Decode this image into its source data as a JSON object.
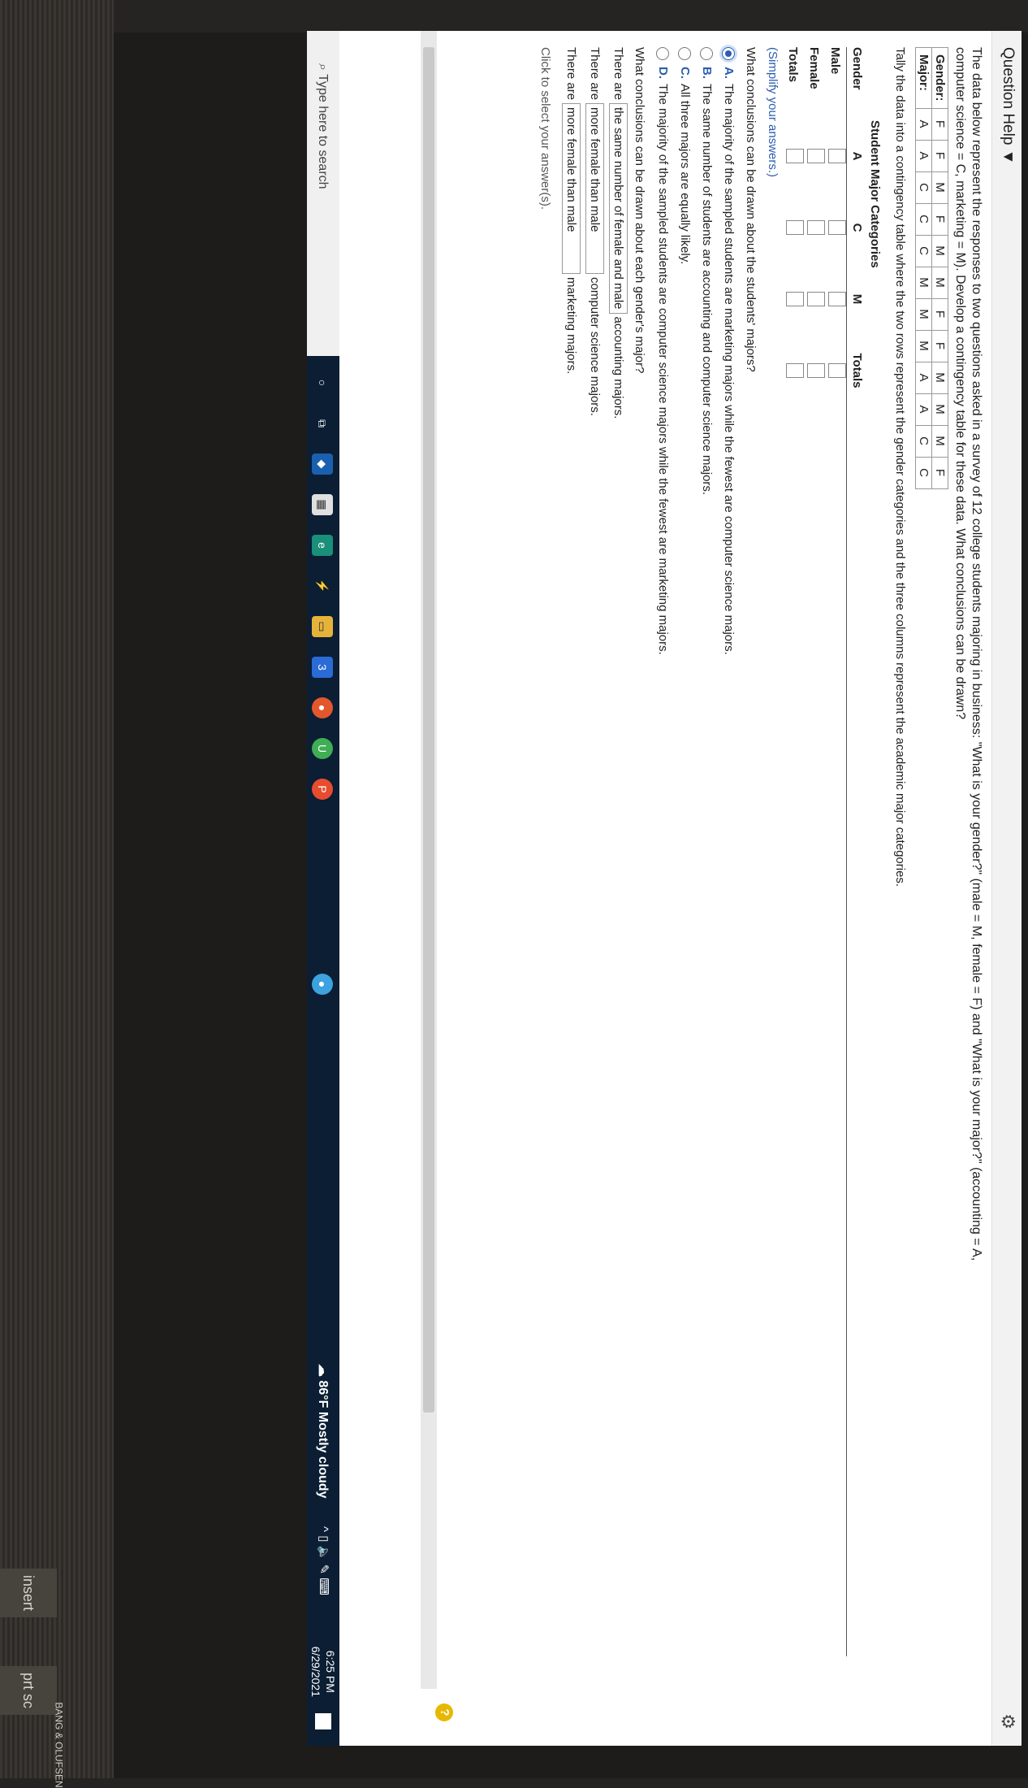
{
  "window": {
    "question_help": "Question Help ▼"
  },
  "problem": {
    "prompt": "The data below represent the responses to two questions asked in a survey of 12 college students majoring in business: \"What is your gender?\" (male = M, female = F) and \"What is your major?\" (accounting = A, computer science = C, marketing = M). Develop a contingency table for these data. What conclusions can be drawn?",
    "gender_label": "Gender:",
    "major_label": "Major:",
    "genders": [
      "F",
      "F",
      "M",
      "F",
      "M",
      "M",
      "F",
      "F",
      "M",
      "M",
      "M",
      "F"
    ],
    "majors": [
      "A",
      "A",
      "C",
      "C",
      "C",
      "M",
      "M",
      "M",
      "A",
      "A",
      "C",
      "C"
    ],
    "instruction": "Tally the data into a contingency table where the two rows represent the gender categories and the three columns represent the academic major categories.",
    "table_title": "Student Major Categories",
    "col_headers": [
      "Gender",
      "A",
      "C",
      "M",
      "Totals"
    ],
    "row_labels": [
      "Male",
      "Female",
      "Totals"
    ],
    "simplify": "(Simplify your answers.)",
    "question": "What conclusions can be drawn about the students' majors?",
    "choices": [
      {
        "letter": "A.",
        "text": "The majority of the sampled students are marketing majors while the fewest are computer science majors.",
        "selected": true
      },
      {
        "letter": "B.",
        "text": "The same number of students are accounting and computer science majors.",
        "selected": false
      },
      {
        "letter": "C.",
        "text": "All three majors are equally likely.",
        "selected": false
      },
      {
        "letter": "D.",
        "text": "The majority of the sampled students are computer science majors while the fewest are marketing majors.",
        "selected": false
      }
    ],
    "gender_question": "What conclusions can be drawn about each gender's major?",
    "gender_lines": [
      {
        "prefix": "There are",
        "selection": "the same number of female and male",
        "suffix": "accounting majors."
      },
      {
        "prefix": "There are",
        "selection": "more female than male",
        "suffix": "computer science majors."
      },
      {
        "prefix": "There are",
        "selection": "more female than male",
        "suffix": "marketing majors."
      }
    ],
    "click_hint": "Click to select your answer(s)."
  },
  "taskbar": {
    "search_placeholder": "Type here to search",
    "weather": "86°F  Mostly cloudy",
    "time": "6:25 PM",
    "date": "6/29/2021",
    "mail_badge": "3"
  },
  "keyboard": {
    "keys": [
      "prt sc",
      "insert",
      "BANG & OLUFSEN"
    ]
  },
  "colors": {
    "accent": "#2a5db0",
    "taskbar": "#0b1e33"
  }
}
